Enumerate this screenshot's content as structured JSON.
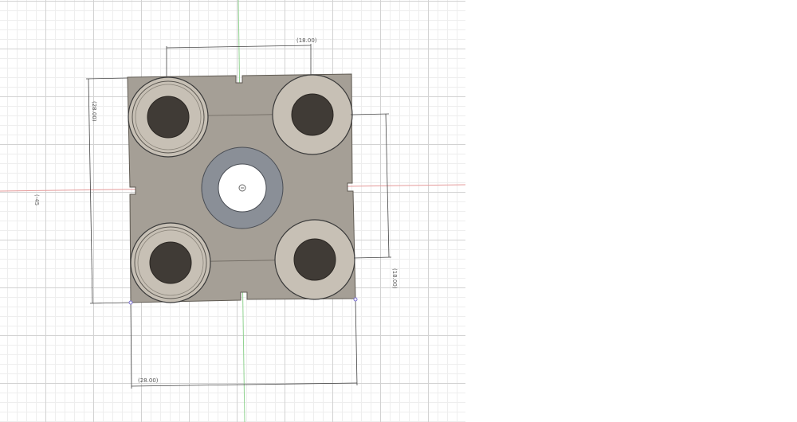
{
  "dimensions": {
    "top_width": "(18.00)",
    "left_height": "(28.00)",
    "right_height": "(18.00)",
    "bottom_width": "(28.00)"
  },
  "axis_label": "(-45",
  "colors": {
    "plate": "#a59f96",
    "plate_edge": "#5f5a52",
    "boss_ring": "#c7c0b5",
    "post_dark": "#403b36",
    "center_ring": "#8a8f97",
    "axis_red": "#e59a9a",
    "axis_green": "#8fd28f",
    "dim_line": "#444444"
  }
}
